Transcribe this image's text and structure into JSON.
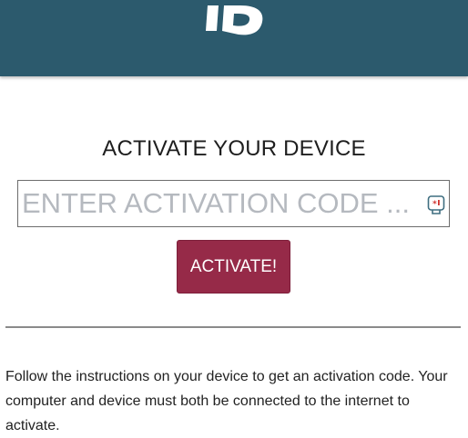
{
  "header": {
    "logo_icon": "id-logo-icon",
    "background_color": "#2c5a6d"
  },
  "main": {
    "title": "ACTIVATE YOUR DEVICE",
    "code_input": {
      "value": "",
      "placeholder": "ENTER ACTIVATION CODE ..."
    },
    "field_icon": "password-manager-icon",
    "activate_button_label": "ACTIVATE!",
    "accent_color": "#962a48",
    "instructions": "Follow the instructions on your device to get an activation code. Your computer and device must both be connected to the internet to activate."
  }
}
